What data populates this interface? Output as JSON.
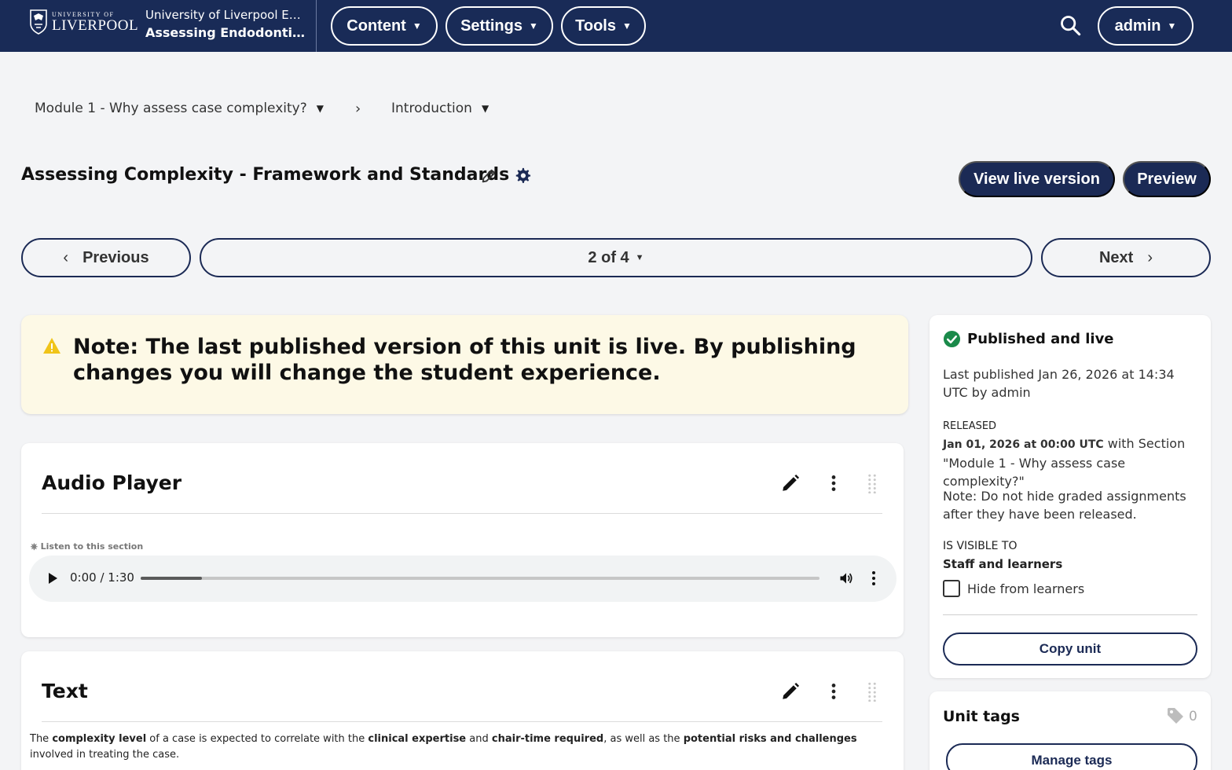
{
  "header": {
    "logo_small": "UNIVERSITY OF",
    "logo_big": "LIVERPOOL",
    "org": "University of Liverpool EN...",
    "course": "Assessing Endodonti...",
    "nav": {
      "content": "Content",
      "settings": "Settings",
      "tools": "Tools"
    },
    "user": "admin"
  },
  "breadcrumb": {
    "section": "Module 1 - Why assess case complexity?",
    "subsection": "Introduction"
  },
  "unit": {
    "title": "Assessing Complexity - Framework and Standards",
    "view_live": "View live version",
    "preview": "Preview"
  },
  "pager": {
    "previous": "Previous",
    "position": "2 of 4",
    "next": "Next"
  },
  "warning": {
    "text": "Note: The last published version of this unit is live. By publishing changes you will change the student experience."
  },
  "blocks": {
    "audio": {
      "title": "Audio Player",
      "label": "Listen to this section",
      "time": "0:00 / 1:30",
      "progress": 0.09
    },
    "text": {
      "title": "Text",
      "body_parts": [
        "The ",
        "complexity level",
        " of a case is expected to correlate with the ",
        "clinical expertise",
        " and ",
        "chair-time required",
        ", as well as the ",
        "potential risks and challenges",
        " involved in treating the case."
      ]
    }
  },
  "sidebar": {
    "status": "Published and live",
    "last_published": "Last published Jan 26, 2026 at 14:34 UTC by admin",
    "released_label": "RELEASED",
    "released_date": "Jan 01, 2026 at 00:00 UTC",
    "released_with": " with Section",
    "released_section": "\"Module 1 - Why assess case complexity?\"",
    "note": "Note: Do not hide graded assignments after they have been released.",
    "visible_label": "IS VISIBLE TO",
    "visible_value": "Staff and learners",
    "hide_label": "Hide from learners",
    "copy_unit": "Copy unit",
    "tags_title": "Unit tags",
    "tags_count": "0",
    "manage_tags": "Manage tags"
  },
  "colors": {
    "header_bg": "#192b57",
    "primary": "#1b2a55",
    "warning_bg": "#fdf9e6",
    "success": "#1a8a4a",
    "warning_icon": "#f0c419"
  }
}
